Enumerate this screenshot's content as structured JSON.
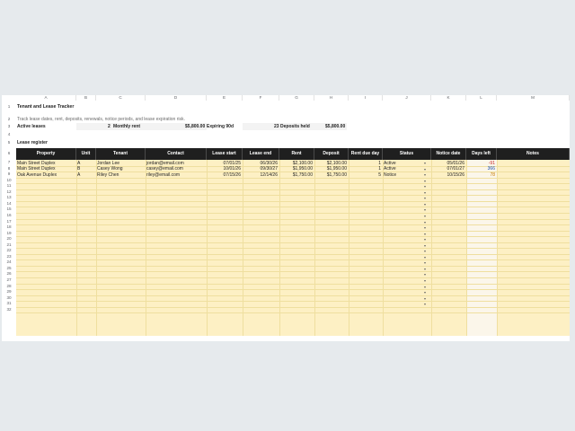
{
  "columns": [
    "A",
    "B",
    "C",
    "D",
    "E",
    "F",
    "G",
    "H",
    "I",
    "J",
    "K",
    "L",
    "M"
  ],
  "title": "Tenant and Lease Tracker",
  "subtitle": "Track lease dates, rent, deposits, renewals, notice periods, and lease expiration risk.",
  "summary": {
    "active_label": "Active leases",
    "active_value": "2",
    "monthly_label": "Monthly rent",
    "monthly_value": "$5,800.00",
    "expiring_label": "Expiring 90d",
    "expiring_value": "23",
    "deposits_label": "Deposits held",
    "deposits_value": "$5,800.00"
  },
  "section_label": "Lease register",
  "headers": [
    "Property",
    "Unit",
    "Tenant",
    "Contact",
    "Lease start",
    "Lease end",
    "Rent",
    "Deposit",
    "Rent due day",
    "Status",
    "Notice date",
    "Days left",
    "Notes"
  ],
  "leases": [
    {
      "property": "Main Street Duplex",
      "unit": "A",
      "tenant": "Jordan Lee",
      "contact": "jordan@email.com",
      "start": "07/01/25",
      "end": "06/30/26",
      "rent": "$2,100.00",
      "deposit": "$2,100.00",
      "due": "1",
      "status": "Active",
      "notice": "05/01/26",
      "days": "-91",
      "days_color": "#c62828"
    },
    {
      "property": "Main Street Duplex",
      "unit": "B",
      "tenant": "Casey Wong",
      "contact": "casey@email.com",
      "start": "10/01/26",
      "end": "09/30/27",
      "rent": "$1,950.00",
      "deposit": "$1,950.00",
      "due": "1",
      "status": "Active",
      "notice": "07/01/27",
      "days": "366",
      "days_color": "#1a4fb5"
    },
    {
      "property": "Oak Avenue Duplex",
      "unit": "A",
      "tenant": "Riley Chen",
      "contact": "riley@email.com",
      "start": "07/15/26",
      "end": "12/14/26",
      "rent": "$1,750.00",
      "deposit": "$1,750.00",
      "due": "5",
      "status": "Notice",
      "notice": "10/15/26",
      "days": "78",
      "days_color": "#c87a00"
    }
  ],
  "row_numbers": [
    "1",
    "2",
    "3",
    "4",
    "5",
    "6",
    "7",
    "8",
    "9",
    "10",
    "11",
    "12",
    "13",
    "14",
    "15",
    "16",
    "17",
    "18",
    "19",
    "20",
    "21",
    "22",
    "23",
    "24",
    "25",
    "26",
    "27",
    "28",
    "29",
    "30",
    "31",
    "32"
  ],
  "dropdown_glyph": "▾"
}
